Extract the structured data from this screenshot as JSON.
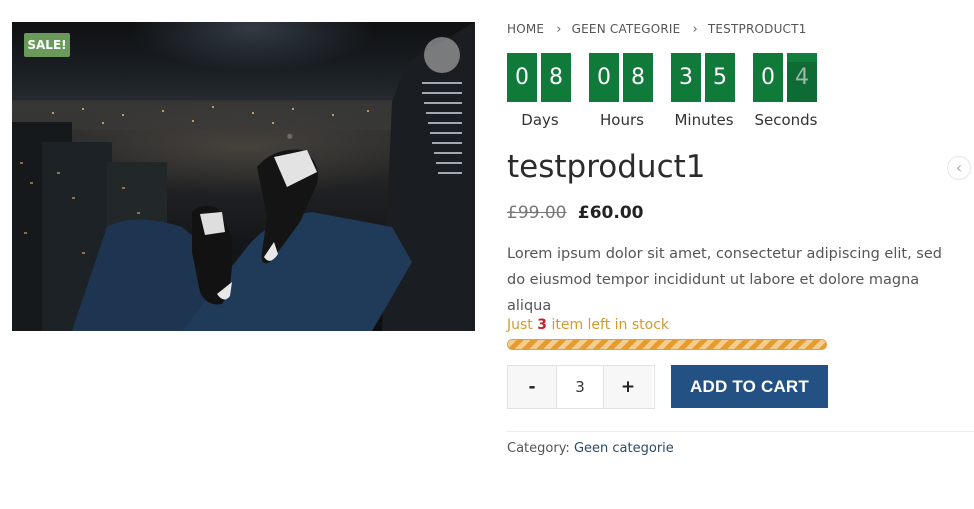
{
  "product_image": {
    "alt": "",
    "sale_badge": "SALE!",
    "zoom_icon": "zoom-circle-icon"
  },
  "breadcrumb": {
    "items": [
      "HOME",
      "GEEN CATEGORIE",
      "TESTPRODUCT1"
    ],
    "separator_icon": "chevron-right-icon"
  },
  "countdown": {
    "units": [
      {
        "digits": [
          "0",
          "8"
        ],
        "label": "Days"
      },
      {
        "digits": [
          "0",
          "8"
        ],
        "label": "Hours"
      },
      {
        "digits": [
          "3",
          "5"
        ],
        "label": "Minutes"
      },
      {
        "digits": [
          "0",
          "4"
        ],
        "label": "Seconds"
      }
    ],
    "color": "#0f7a3a"
  },
  "product": {
    "title": "testproduct1",
    "old_price": "£99.00",
    "price": "£60.00",
    "description": "Lorem ipsum dolor sit amet, consectetur adipiscing elit, sed do eiusmod tempor incididunt ut labore et dolore magna aliqua"
  },
  "stock": {
    "prefix": "Just",
    "quantity": "3",
    "suffix": "item left in stock",
    "level_fraction": 1.0,
    "color": "#d49a2a"
  },
  "cart": {
    "minus_label": "-",
    "quantity_value": "3",
    "plus_label": "+",
    "add_label": "ADD TO CART",
    "button_color": "#235183"
  },
  "meta": {
    "category_label": "Category:",
    "category_value": "Geen categorie"
  },
  "nav": {
    "prev_icon": "chevron-left-icon",
    "prev_glyph": "‹"
  }
}
